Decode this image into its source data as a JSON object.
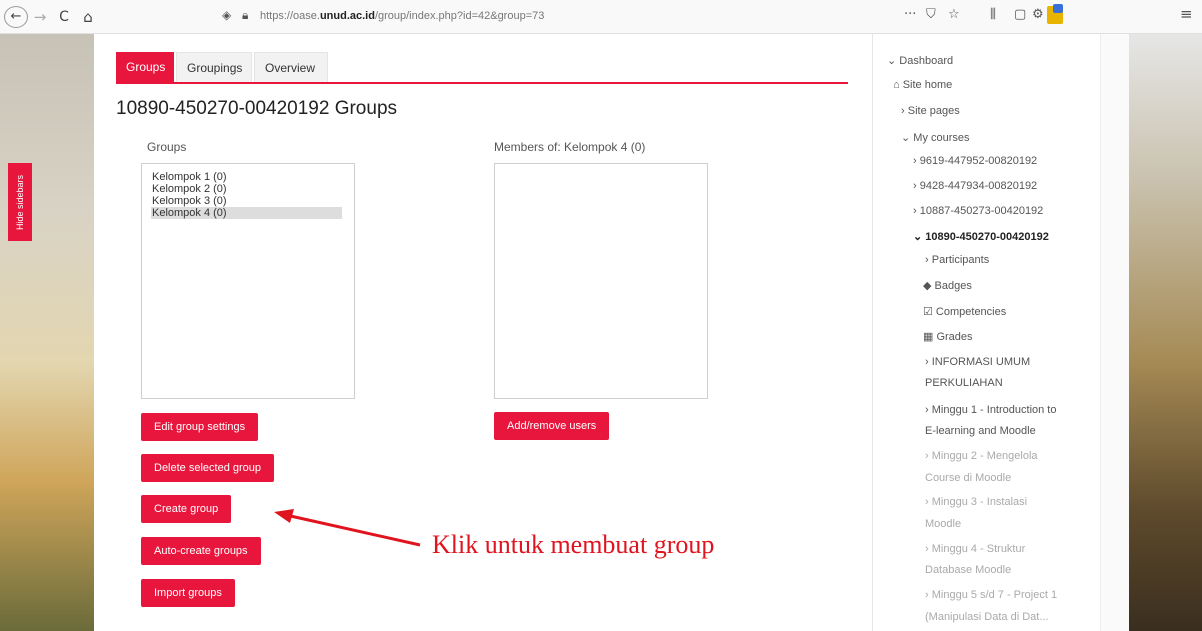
{
  "browser": {
    "back": "←",
    "forward": "→",
    "reload": "C",
    "home": "⌂",
    "url_prefix": "https://oase.",
    "url_domain": "unud.ac.id",
    "url_path": "/group/index.php?id=42&group=73",
    "menu_dots": "···",
    "pocket": "⛉",
    "star": "☆",
    "library": "⫼",
    "sidebar": "▢",
    "account": "⚙",
    "hamburger": "≡"
  },
  "hide_sidebars": "Hide sidebars",
  "tabs": [
    {
      "label": "Groups"
    },
    {
      "label": "Groupings"
    },
    {
      "label": "Overview"
    }
  ],
  "page_title": "10890-450270-00420192 Groups",
  "groups": {
    "label": "Groups",
    "options": [
      "Kelompok 1 (0)",
      "Kelompok 2 (0)",
      "Kelompok 3 (0)",
      "Kelompok 4 (0)"
    ],
    "selected": "Kelompok 4 (0)"
  },
  "members": {
    "label": "Members of: Kelompok 4 (0)"
  },
  "buttons": {
    "edit_group": "Edit group settings",
    "delete_group": "Delete selected group",
    "create_group": "Create group",
    "auto_create": "Auto-create groups",
    "import_groups": "Import groups",
    "add_remove": "Add/remove users"
  },
  "annotation": "Klik untuk membuat group",
  "nav": {
    "dashboard": "Dashboard",
    "site_home": "Site home",
    "site_pages": "Site pages",
    "my_courses": "My courses",
    "course1": "9619-447952-00820192",
    "course2": "9428-447934-00820192",
    "course3": "10887-450273-00420192",
    "course4": "10890-450270-00420192",
    "participants": "Participants",
    "badges": "Badges",
    "competencies": "Competencies",
    "grades": "Grades",
    "sec1_l1": "INFORMASI UMUM",
    "sec1_l2": "PERKULIAHAN",
    "sec2_l1": "Minggu 1 - Introduction to",
    "sec2_l2": "E-learning and Moodle",
    "sec3_l1": "Minggu 2 - Mengelola",
    "sec3_l2": "Course di Moodle",
    "sec4_l1": "Minggu 3 - Instalasi",
    "sec4_l2": "Moodle",
    "sec5_l1": "Minggu 4 - Struktur",
    "sec5_l2": "Database Moodle",
    "sec6_l1": "Minggu 5 s/d 7 - Project 1",
    "sec6_l2": "(Manipulasi Data di Dat..."
  },
  "colors": {
    "accent": "#e8163d",
    "annotation": "#e0141e"
  }
}
